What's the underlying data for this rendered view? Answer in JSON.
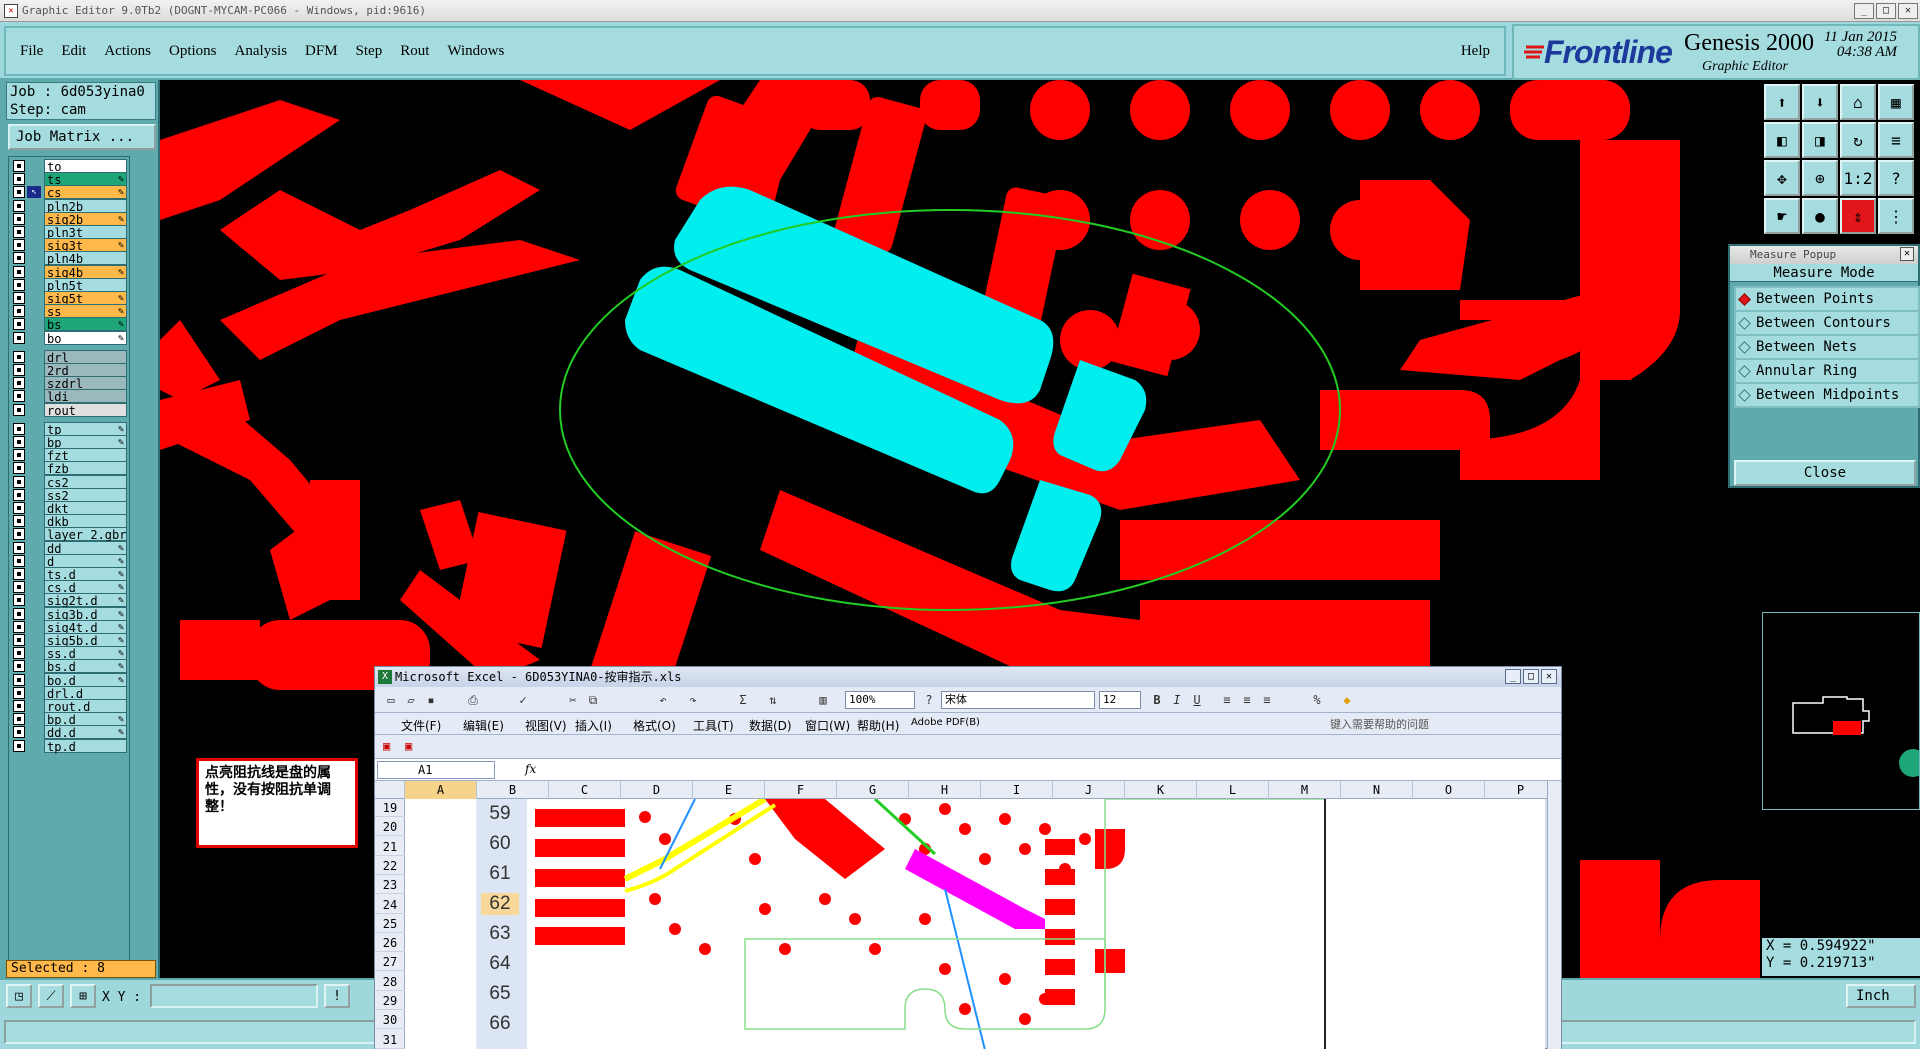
{
  "app": {
    "window_title": "Graphic Editor 9.0Tb2 (DOGNT-MYCAM-PC066 - Windows, pid:9616)",
    "title_icon": "x-icon"
  },
  "menu": {
    "items": [
      "File",
      "Edit",
      "Actions",
      "Options",
      "Analysis",
      "DFM",
      "Step",
      "Rout",
      "Windows"
    ],
    "help": "Help"
  },
  "brand": {
    "logo": "Frontline",
    "product": "Genesis 2000",
    "subtitle": "Graphic Editor",
    "date": "11 Jan 2015",
    "time": "04:38 AM"
  },
  "job": {
    "job_line": "Job : 6d053yina0",
    "step_line": "Step: cam",
    "matrix_button": "Job Matrix ..."
  },
  "layers": [
    {
      "name": "to",
      "color": "#ffffff",
      "edit": false
    },
    {
      "name": "ts",
      "color": "#1ea67a",
      "edit": true
    },
    {
      "name": "cs",
      "color": "#ffb94a",
      "edit": true,
      "work": true
    },
    {
      "name": "pln2b",
      "color": "#a5dcdf",
      "edit": false
    },
    {
      "name": "sig2b",
      "color": "#ffb94a",
      "edit": true
    },
    {
      "name": "pln3t",
      "color": "#a5dcdf",
      "edit": false
    },
    {
      "name": "sig3t",
      "color": "#ffb94a",
      "edit": true
    },
    {
      "name": "pln4b",
      "color": "#a5dcdf",
      "edit": false
    },
    {
      "name": "sig4b",
      "color": "#ffb94a",
      "edit": true
    },
    {
      "name": "pln5t",
      "color": "#a5dcdf",
      "edit": false
    },
    {
      "name": "sig5t",
      "color": "#ffb94a",
      "edit": true
    },
    {
      "name": "ss",
      "color": "#ffb94a",
      "edit": true
    },
    {
      "name": "bs",
      "color": "#1ea67a",
      "edit": true
    },
    {
      "name": "bo",
      "color": "#ffffff",
      "edit": true
    },
    {
      "name": "drl",
      "color": "#9bb8bd",
      "edit": false
    },
    {
      "name": "2rd",
      "color": "#9bb8bd",
      "edit": false
    },
    {
      "name": "szdrl",
      "color": "#9bb8bd",
      "edit": false
    },
    {
      "name": "ldi",
      "color": "#9bb8bd",
      "edit": false
    },
    {
      "name": "rout",
      "color": "#e0e0e0",
      "edit": false
    },
    {
      "name": "tp",
      "color": "#a5dcdf",
      "edit": true
    },
    {
      "name": "bp",
      "color": "#a5dcdf",
      "edit": true
    },
    {
      "name": "fzt",
      "color": "#a5dcdf",
      "edit": false
    },
    {
      "name": "fzb",
      "color": "#a5dcdf",
      "edit": false
    },
    {
      "name": "cs2",
      "color": "#a5dcdf",
      "edit": false
    },
    {
      "name": "ss2",
      "color": "#a5dcdf",
      "edit": false
    },
    {
      "name": "dkt",
      "color": "#a5dcdf",
      "edit": false
    },
    {
      "name": "dkb",
      "color": "#a5dcdf",
      "edit": false
    },
    {
      "name": "layer_2.gbr",
      "color": "#a5dcdf",
      "edit": false
    },
    {
      "name": "dd",
      "color": "#a5dcdf",
      "edit": true
    },
    {
      "name": "d",
      "color": "#a5dcdf",
      "edit": true
    },
    {
      "name": "ts.d",
      "color": "#a5dcdf",
      "edit": true
    },
    {
      "name": "cs.d",
      "color": "#a5dcdf",
      "edit": true
    },
    {
      "name": "sig2t.d",
      "color": "#a5dcdf",
      "edit": true
    },
    {
      "name": "sig3b.d",
      "color": "#a5dcdf",
      "edit": true
    },
    {
      "name": "sig4t.d",
      "color": "#a5dcdf",
      "edit": true
    },
    {
      "name": "sig5b.d",
      "color": "#a5dcdf",
      "edit": true
    },
    {
      "name": "ss.d",
      "color": "#a5dcdf",
      "edit": true
    },
    {
      "name": "bs.d",
      "color": "#a5dcdf",
      "edit": true
    },
    {
      "name": "bo.d",
      "color": "#a5dcdf",
      "edit": true
    },
    {
      "name": "drl.d",
      "color": "#a5dcdf",
      "edit": false
    },
    {
      "name": "rout.d",
      "color": "#a5dcdf",
      "edit": false
    },
    {
      "name": "bp.d",
      "color": "#a5dcdf",
      "edit": true
    },
    {
      "name": "dd.d",
      "color": "#a5dcdf",
      "edit": true
    },
    {
      "name": "tp.d",
      "color": "#a5dcdf",
      "edit": false
    }
  ],
  "status": {
    "selected": "Selected : 8",
    "xy_label": "X Y :",
    "units": "Inch",
    "x": "X = 0.594922\"",
    "y": "Y = 0.219713\""
  },
  "measure": {
    "title": "Measure Popup",
    "heading": "Measure Mode",
    "options": [
      "Between Points",
      "Between Contours",
      "Between Nets",
      "Annular Ring",
      "Between Midpoints"
    ],
    "active": "Between Points",
    "close": "Close"
  },
  "note": {
    "text": "点亮阻抗线是盘的属性，没有按阻抗单调整！"
  },
  "excel": {
    "title": "Microsoft Excel - 6D053YINA0-按审指示.xls",
    "zoom": "100%",
    "font": "宋体",
    "font_size": "12",
    "menu": [
      "文件(F)",
      "编辑(E)",
      "视图(V)",
      "插入(I)",
      "格式(O)",
      "工具(T)",
      "数据(D)",
      "窗口(W)",
      "帮助(H)",
      "Adobe PDF(B)"
    ],
    "ask": "键入需要帮助的问题",
    "cell_ref": "A1",
    "fx": "fx",
    "columns": [
      "A",
      "B",
      "C",
      "D",
      "E",
      "F",
      "G",
      "H",
      "I",
      "J",
      "K",
      "L",
      "M",
      "N",
      "O",
      "P"
    ],
    "rows": [
      "19",
      "20",
      "21",
      "22",
      "23",
      "24",
      "25",
      "26",
      "27",
      "28",
      "29",
      "30",
      "31"
    ],
    "image_numbers": [
      "59",
      "60",
      "61",
      "62",
      "63",
      "64",
      "65",
      "66"
    ],
    "highlight_number": "62"
  },
  "colors": {
    "panel": "#9ed8dc",
    "copper": "#ff0000",
    "selected": "#00eeee",
    "ellipse": "#22cc22",
    "excel_magenta": "#ff00ff",
    "excel_yellow": "#ffff00",
    "arrow_blue": "#1e90ff"
  }
}
